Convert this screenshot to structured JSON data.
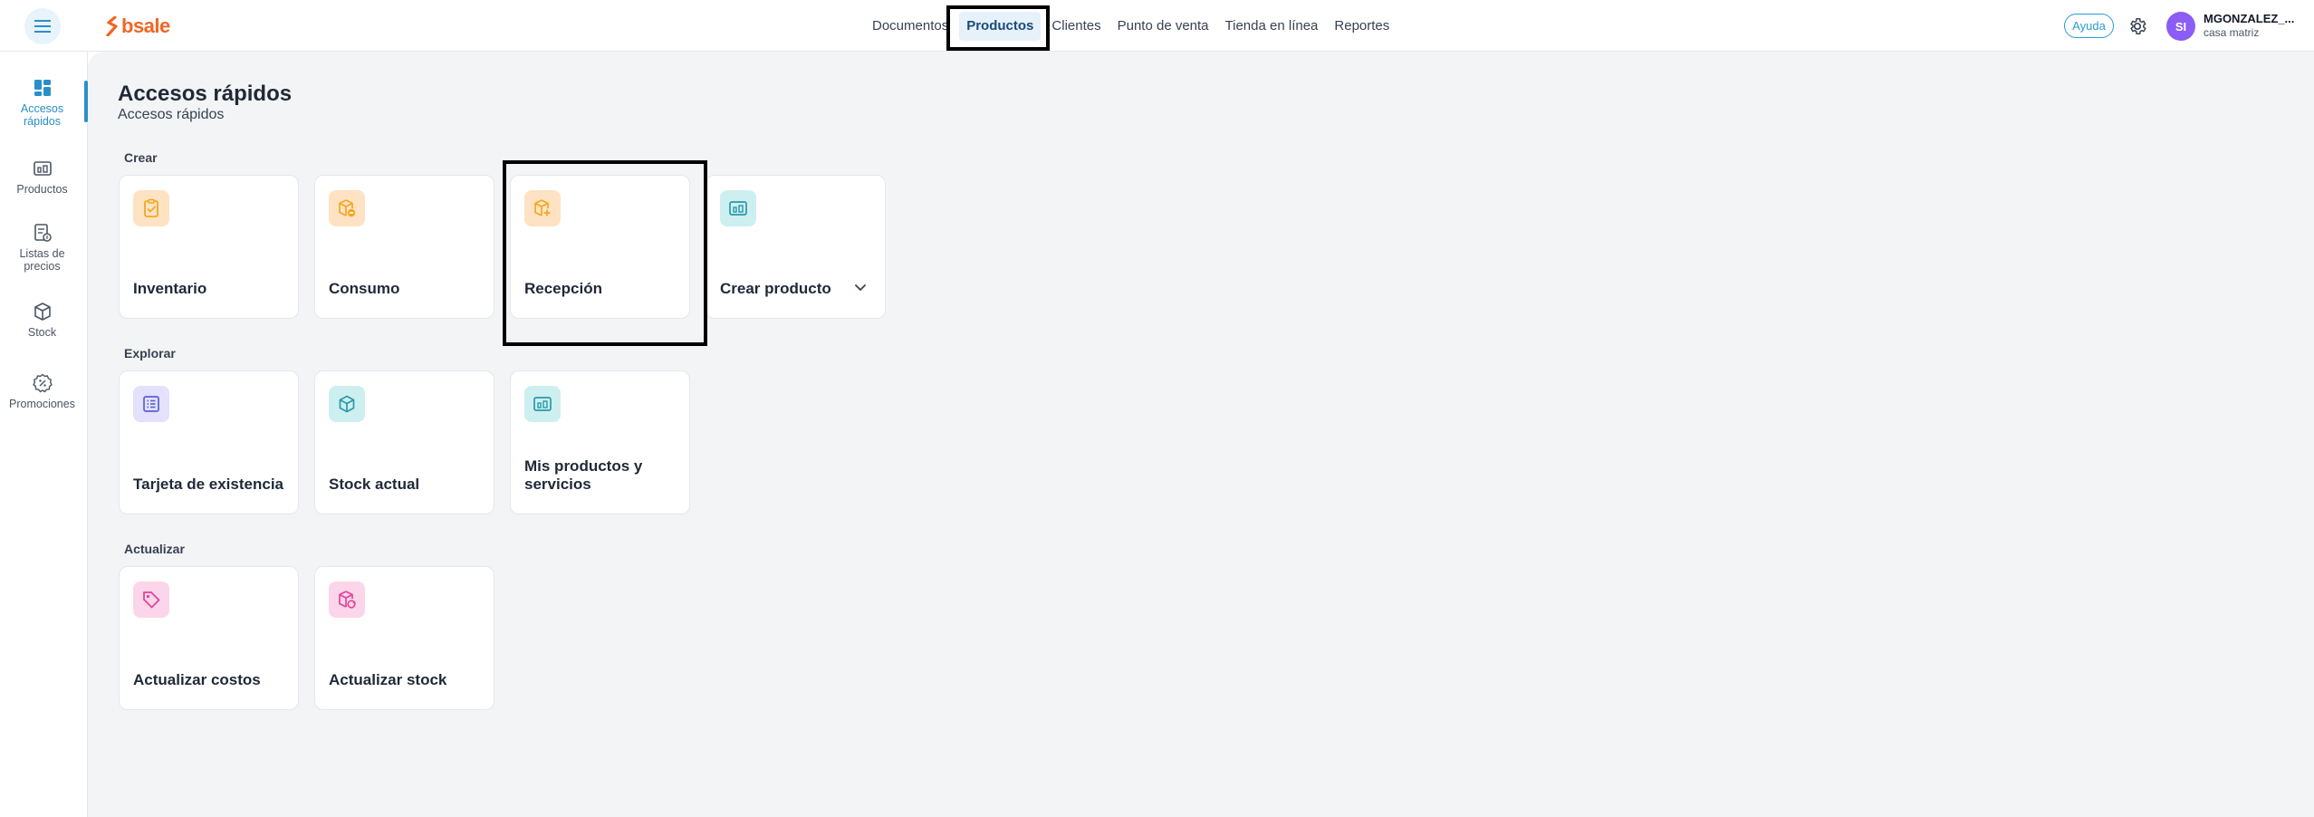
{
  "header": {
    "logo_text": "bsale",
    "nav": [
      {
        "label": "Documentos"
      },
      {
        "label": "Productos"
      },
      {
        "label": "Clientes"
      },
      {
        "label": "Punto de venta"
      },
      {
        "label": "Tienda en línea"
      },
      {
        "label": "Reportes"
      }
    ],
    "active_nav": "Productos",
    "help_label": "Ayuda",
    "user_initials": "SI",
    "user_name": "MGONZALEZ_...",
    "user_branch": "casa matriz"
  },
  "sidebar": {
    "items": [
      {
        "label": "Accesos rápidos",
        "icon": "dashboard-icon",
        "active": true
      },
      {
        "label": "Productos",
        "icon": "products-icon"
      },
      {
        "label": "Listas de precios",
        "icon": "price-list-icon"
      },
      {
        "label": "Stock",
        "icon": "box-icon"
      },
      {
        "label": "Promociones",
        "icon": "promo-icon"
      }
    ]
  },
  "main": {
    "title": "Accesos rápidos",
    "subtitle": "Accesos rápidos",
    "sections": [
      {
        "label": "Crear",
        "cards": [
          {
            "label": "Inventario",
            "icon": "clipboard-check-icon"
          },
          {
            "label": "Consumo",
            "icon": "box-minus-icon"
          },
          {
            "label": "Recepción",
            "icon": "box-plus-icon"
          },
          {
            "label": "Crear producto",
            "icon": "products-icon"
          }
        ]
      },
      {
        "label": "Explorar",
        "cards": [
          {
            "label": "Tarjeta de existencia",
            "icon": "list-icon"
          },
          {
            "label": "Stock actual",
            "icon": "cube-icon"
          },
          {
            "label": "Mis productos y servicios",
            "icon": "products-icon"
          }
        ]
      },
      {
        "label": "Actualizar",
        "cards": [
          {
            "label": "Actualizar costos",
            "icon": "tag-icon"
          },
          {
            "label": "Actualizar stock",
            "icon": "box-refresh-icon"
          }
        ]
      }
    ]
  },
  "colors": {
    "brand": "#f26522",
    "accent": "#2a8fc8",
    "orange_icon": "#f5a623",
    "teal_icon": "#2a9aa8",
    "purple_icon": "#5b5fd6",
    "pink_icon": "#e0449a"
  }
}
